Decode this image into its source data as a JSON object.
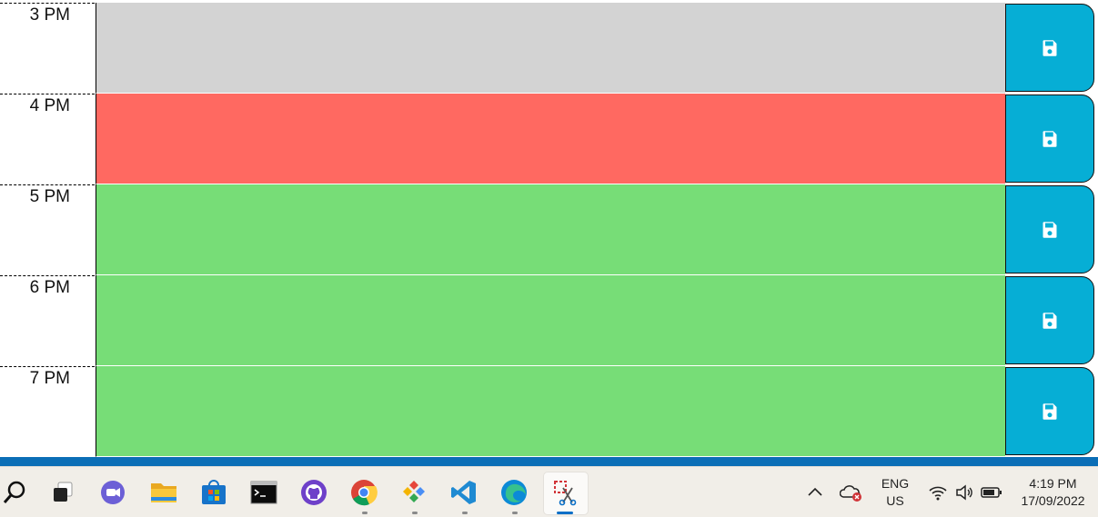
{
  "scheduler": {
    "rows": [
      {
        "hour": "3 PM",
        "status": "past",
        "text": "",
        "save_icon": "floppy-disk-icon"
      },
      {
        "hour": "4 PM",
        "status": "present",
        "text": "",
        "save_icon": "floppy-disk-icon"
      },
      {
        "hour": "5 PM",
        "status": "future",
        "text": "",
        "save_icon": "floppy-disk-icon"
      },
      {
        "hour": "6 PM",
        "status": "future",
        "text": "",
        "save_icon": "floppy-disk-icon"
      },
      {
        "hour": "7 PM",
        "status": "future",
        "text": "",
        "save_icon": "floppy-disk-icon"
      }
    ],
    "colors": {
      "past": "#d3d3d3",
      "present": "#ff6961",
      "future": "#77dd77",
      "save_button": "#06aed5"
    }
  },
  "taskbar": {
    "apps": [
      {
        "name": "search-icon"
      },
      {
        "name": "task-view-icon"
      },
      {
        "name": "teams-chat-icon"
      },
      {
        "name": "file-explorer-icon"
      },
      {
        "name": "microsoft-store-icon"
      },
      {
        "name": "terminal-icon"
      },
      {
        "name": "github-desktop-icon"
      },
      {
        "name": "chrome-icon"
      },
      {
        "name": "git-kraken-icon"
      },
      {
        "name": "vscode-icon"
      },
      {
        "name": "edge-icon"
      },
      {
        "name": "snipping-tool-icon"
      }
    ],
    "tray": {
      "language_line1": "ENG",
      "language_line2": "US",
      "time": "4:19 PM",
      "date": "17/09/2022"
    }
  }
}
